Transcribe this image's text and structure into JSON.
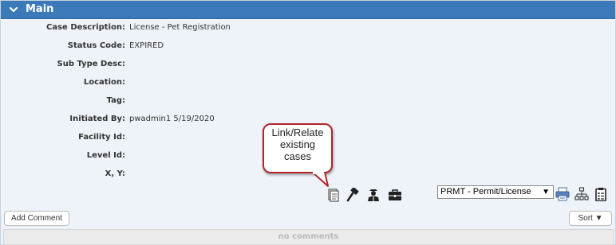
{
  "section": {
    "title": "Main",
    "toggle_icon": "chevron-down-icon"
  },
  "fields": [
    {
      "label": "Case Description:",
      "value": "License - Pet Registration"
    },
    {
      "label": "Status Code:",
      "value": "EXPIRED"
    },
    {
      "label": "Sub Type Desc:",
      "value": ""
    },
    {
      "label": "Location:",
      "value": ""
    },
    {
      "label": "Tag:",
      "value": ""
    },
    {
      "label": "Initiated By:",
      "value": "pwadmin1 5/19/2020"
    },
    {
      "label": "Facility Id:",
      "value": ""
    },
    {
      "label": "Level Id:",
      "value": ""
    },
    {
      "label": "X, Y:",
      "value": ""
    }
  ],
  "callout": {
    "lines": [
      "Link/Relate",
      "existing",
      "cases"
    ]
  },
  "actions": {
    "icons": [
      "document-link-icon",
      "gavel-icon",
      "inspector-icon",
      "briefcase-icon"
    ]
  },
  "case_type_select": {
    "value": "PRMT - Permit/License",
    "arrow": "▼"
  },
  "tools": {
    "icons": [
      "printer-icon",
      "sitemap-icon",
      "clipboard-icon"
    ]
  },
  "comments": {
    "add_label": "Add Comment",
    "sort_label": "Sort",
    "sort_arrow": "▼",
    "empty_text": "no comments"
  },
  "colors": {
    "header_bg": "#3b79b8",
    "panel_bg": "#edf3f8",
    "callout_border": "#b3242a"
  }
}
